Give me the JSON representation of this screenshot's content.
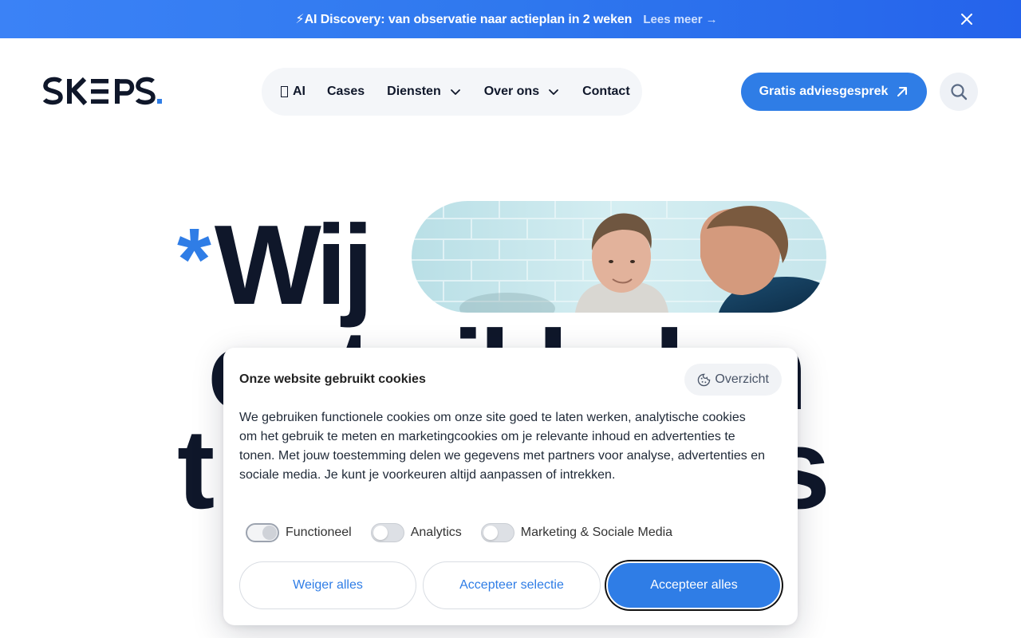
{
  "announcement": {
    "bolt": "⚡",
    "text": "AI Discovery: van observatie naar actieplan in 2 weken",
    "link": "Lees meer",
    "link_arrow": "→",
    "close_icon": "close-icon"
  },
  "header": {
    "logo_text": "SKEPS.",
    "nav": [
      {
        "label": "AI",
        "icon": "ai-box-icon"
      },
      {
        "label": "Cases"
      },
      {
        "label": "Diensten",
        "dropdown": true
      },
      {
        "label": "Over ons",
        "dropdown": true
      },
      {
        "label": "Contact"
      }
    ],
    "cta_label": "Gratis adviesgesprek",
    "cta_icon": "arrow-up-right-icon",
    "search_icon": "search-icon"
  },
  "hero": {
    "asterisk": "*",
    "line1": "Wij",
    "line2": "ontwikkelen",
    "line3": "t",
    "line3_end": "s"
  },
  "cookie": {
    "title": "Onze website gebruikt cookies",
    "overview_label": "Overzicht",
    "overview_icon": "cookie-icon",
    "body": "We gebruiken functionele cookies om onze site goed te laten werken, analytische cookies om het gebruik te meten en marketingcookies om je relevante inhoud en advertenties te tonen. Met jouw toestemming delen we gegevens met partners voor analyse, advertenties en sociale media. Je kunt je voorkeuren altijd aanpassen of intrekken.",
    "toggles": [
      {
        "label": "Functioneel",
        "state": "on"
      },
      {
        "label": "Analytics",
        "state": "off"
      },
      {
        "label": "Marketing & Sociale Media",
        "state": "off"
      }
    ],
    "buttons": {
      "reject": "Weiger alles",
      "selection": "Accepteer selectie",
      "accept_all": "Accepteer alles"
    }
  },
  "colors": {
    "accent": "#2f7de6",
    "dark": "#0f172a",
    "banner_start": "#3b82f6",
    "banner_end": "#2563eb"
  }
}
